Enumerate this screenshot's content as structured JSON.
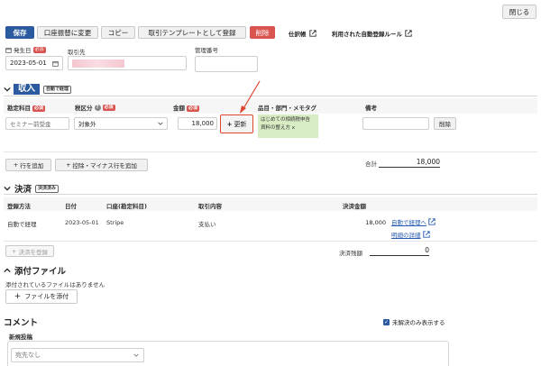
{
  "window": {
    "close_label": "閉じる"
  },
  "toolbar": {
    "save": "保存",
    "change_transfer": "口座振替に変更",
    "copy": "コピー",
    "register_template": "取引テンプレートとして登録",
    "delete": "削除",
    "journal_link": "仕訳帳",
    "auto_rule_link": "利用された自動登録ルール"
  },
  "header": {
    "date_label": "発生日",
    "date_required": "必須",
    "date_value": "2023-05-01",
    "partner_label": "取引先",
    "control_number_label": "管理番号",
    "control_number_value": ""
  },
  "income": {
    "title": "収入",
    "auto_tag": "自動で経理",
    "columns": {
      "account": "勘定科目",
      "tax": "税区分",
      "amount": "金額",
      "items": "品目・部門・メモタグ",
      "notes": "備考"
    },
    "required": "必須",
    "row": {
      "account_value": "セミナー前受金",
      "tax_value": "対象外",
      "amount_value": "18,000",
      "update_button": "更新",
      "tags": [
        "はじめての相続税申告",
        "資料の整え方 x"
      ],
      "notes_value": "",
      "delete_button": "削除"
    },
    "add_row": "行を追加",
    "add_deduction_row": "控除・マイナス行を追加",
    "total_label": "合計",
    "total_value": "18,000"
  },
  "settlement": {
    "title": "決済",
    "status_tag": "決済済み",
    "columns": {
      "method": "登録方法",
      "date": "日付",
      "account": "口座(勘定科目)",
      "content": "取引内容",
      "amount": "決済金額"
    },
    "row": {
      "method": "自動で経理",
      "date": "2023-05-01",
      "account": "Stripe",
      "content": "支払い",
      "amount": "18,000",
      "link_auto": "自動で経理へ",
      "link_detail": "明細の詳細"
    },
    "register_button": "決済を登録",
    "balance_label": "決済残額",
    "balance_value": "0"
  },
  "attachments": {
    "title": "添付ファイル",
    "empty_text": "添付されているファイルはありません",
    "add_button": "ファイルを添付"
  },
  "comments": {
    "title": "コメント",
    "unresolved_only": "未解決のみ表示する",
    "unresolved_checked": true,
    "new_post_label": "新規投稿",
    "recipient_placeholder": "宛先なし"
  },
  "colors": {
    "primary": "#2b5a9e",
    "danger": "#d9534f",
    "link": "#2a5db0",
    "tag_bg": "#d8ecc4",
    "arrow": "#e0452f"
  }
}
